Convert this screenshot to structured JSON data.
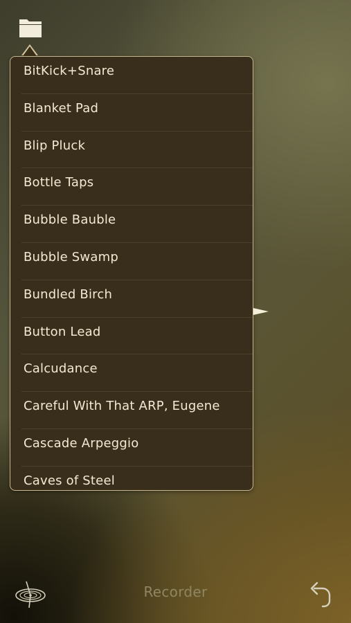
{
  "toolbar": {
    "folder_icon": "folder-icon"
  },
  "preset_list": {
    "items": [
      "BitKick+Snare",
      "Blanket Pad",
      "Blip Pluck",
      "Bottle Taps",
      "Bubble Bauble",
      "Bubble Swamp",
      "Bundled Birch",
      "Button Lead",
      "Calcudance",
      "Careful With That ARP, Eugene",
      "Cascade Arpeggio",
      "Caves of Steel"
    ]
  },
  "footer": {
    "label": "Recorder",
    "left_icon": "turntable-icon",
    "right_icon": "undo-icon"
  },
  "colors": {
    "popover_bg": "#382e1b",
    "popover_border": "#c8b98f",
    "item_text": "#f3ead3",
    "footer_text": "#8e8762"
  }
}
